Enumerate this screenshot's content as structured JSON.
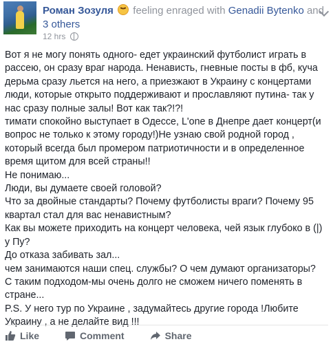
{
  "post": {
    "author": "Роман Зозуля",
    "feeling_text": "feeling enraged with",
    "tagged_person": "Genadii Bytenko",
    "and_text": "and",
    "others_link": "3 others",
    "timestamp": "12 hrs",
    "privacy_icon": "globe-icon",
    "feeling_icon": "enraged-emoji-icon",
    "paragraphs": [
      "Вот я не могу понять одного- едет украинский футболист играть в рассею, он сразу враг народа. Ненависть, гневные посты в фб, куча дерьма сразу льется на него, а приезжают в Украину с концертами люди, которые открыто поддерживают и прославляют путина- так у нас сразу полные залы! Вот как так?!?!",
      "тимати спокойно выступает в Одессе, L'one в Днепре дает концерт(и вопрос не только к этому городу!)Не узнаю свой родной город , который всегда был промером патриотичности и в определенное время щитом для всей страны!!",
      "Не понимаю...",
      "Люди, вы думаете своей головой?",
      "Что за двойные стандарты? Почему футболисты враги? Почему 95 квартал стал для вас ненавистным?",
      "Как вы можете приходить на концерт человека, чей язык глубоко в (|) у Пу?",
      "До отказа забивать зал...",
      "чем занимаются наши спец. службы? О чем думают организаторы?",
      "С таким подходом-мы очень долго не сможем ничего поменять в стране...",
      "P.S. У него тур по Украине , задумайтесь другие города !Любите Украину , а не делайте вид !!!"
    ]
  },
  "actions": {
    "like_label": "Like",
    "comment_label": "Comment",
    "share_label": "Share"
  },
  "colors": {
    "link": "#365899",
    "muted": "#90949c",
    "action": "#616770"
  }
}
